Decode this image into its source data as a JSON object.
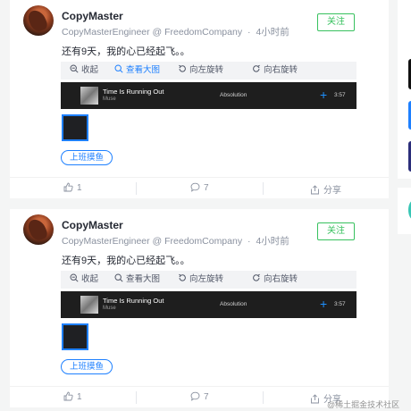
{
  "posts": [
    {
      "author": "CopyMaster",
      "title": "CopyMasterEngineer @ FreedomCompany",
      "time": "4小时前",
      "follow_label": "关注",
      "content": "还有9天，我的心已经起飞。。",
      "toolbar": {
        "collapse": "收起",
        "view_large": "查看大图",
        "rotate_left": "向左旋转",
        "rotate_right": "向右旋转"
      },
      "player": {
        "song": "Time Is Running Out",
        "artist": "Muse",
        "album": "Absolution",
        "duration": "3:57"
      },
      "topic": "上班摸鱼",
      "likes": "1",
      "comments": "7",
      "share_label": "分享"
    },
    {
      "author": "CopyMaster",
      "title": "CopyMasterEngineer @ FreedomCompany",
      "time": "4小时前",
      "follow_label": "关注",
      "content": "还有9天，我的心已经起飞。。",
      "toolbar": {
        "collapse": "收起",
        "view_large": "查看大图",
        "rotate_left": "向左旋转",
        "rotate_right": "向右旋转"
      },
      "player": {
        "song": "Time Is Running Out",
        "artist": "Muse",
        "album": "Absolution",
        "duration": "3:57"
      },
      "topic": "上班摸鱼",
      "likes": "1",
      "comments": "7",
      "share_label": "分享"
    }
  ],
  "watermark": "@稀土掘金技术社区",
  "colors": {
    "accent": "#1e80ff",
    "follow": "#37c15e"
  }
}
